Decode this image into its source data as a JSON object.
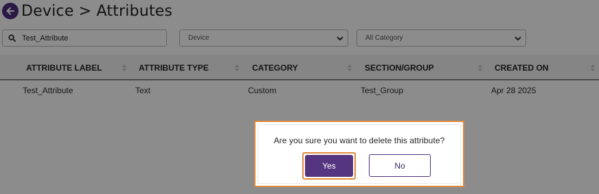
{
  "header": {
    "title": "Device > Attributes"
  },
  "filters": {
    "search_value": "Test_Attribute",
    "device_select": "Device",
    "category_select": "All Category"
  },
  "table": {
    "columns": [
      "ATTRIBUTE LABEL",
      "ATTRIBUTE TYPE",
      "CATEGORY",
      "SECTION/GROUP",
      "CREATED ON"
    ],
    "rows": [
      [
        "Test_Attribute",
        "Text",
        "Custom",
        "Test_Group",
        "Apr 28 2025"
      ]
    ]
  },
  "dialog": {
    "message": "Are you sure you want to delete this attribute?",
    "yes_label": "Yes",
    "no_label": "No"
  },
  "colors": {
    "accent": "#55357f",
    "focus_outline": "#e08a3c"
  }
}
